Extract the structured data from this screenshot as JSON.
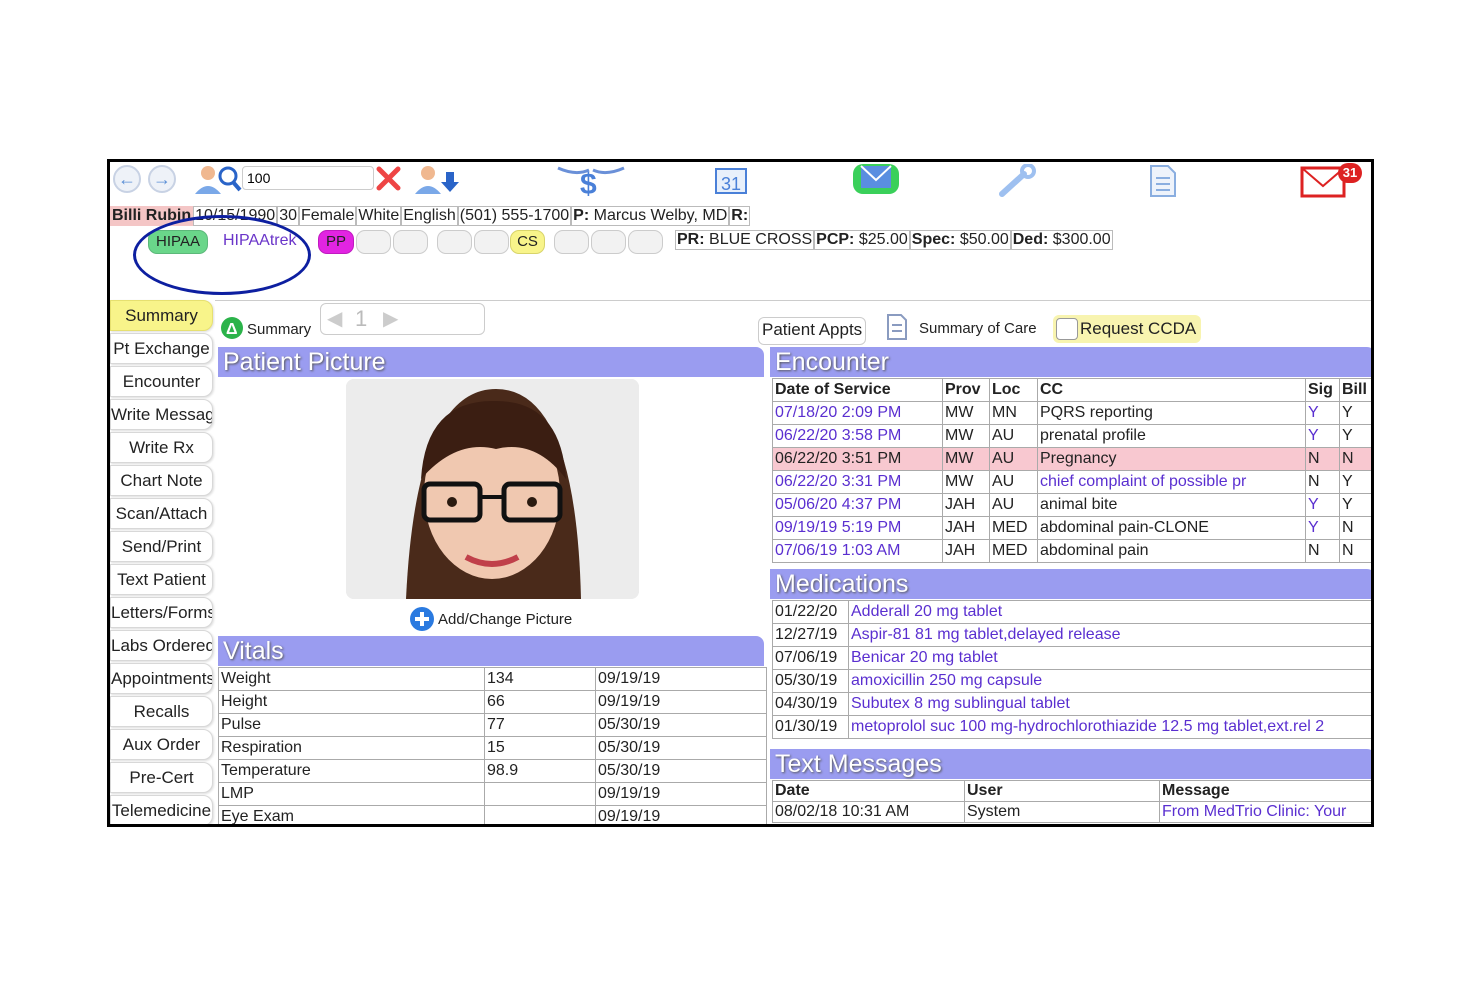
{
  "toolbar": {
    "search_value": "100",
    "mail_badge": "31",
    "icons": [
      "back-icon",
      "forward-icon",
      "patient-search-icon",
      "clear-icon",
      "patient-download-icon",
      "billing-icon",
      "calendar-icon",
      "inbox-icon",
      "tools-icon",
      "document-icon",
      "mail-icon"
    ]
  },
  "patient": {
    "name": "Billi Rubin",
    "dob": "10/15/1990",
    "age": "30",
    "sex": "Female",
    "race": "White",
    "language": "English",
    "phone": "(501) 555-1700",
    "provider_label": "P:",
    "provider": "Marcus Welby, MD",
    "referral_label": "R:"
  },
  "chips": {
    "hipaa": "HIPAA",
    "hipaatrek": "HIPAAtrek",
    "pp": "PP",
    "cs": "CS"
  },
  "insurance": {
    "pr_label": "PR:",
    "pr": "BLUE CROSS",
    "pcp_label": "PCP:",
    "pcp": "$25.00",
    "spec_label": "Spec:",
    "spec": "$50.00",
    "ded_label": "Ded:",
    "ded": "$300.00"
  },
  "sidebar": [
    "Summary",
    "Pt Exchange",
    "Encounter",
    "Write Message",
    "Write Rx",
    "Chart Note",
    "Scan/Attach",
    "Send/Print",
    "Text Patient",
    "Letters/Forms",
    "Labs Ordered",
    "Appointments",
    "Recalls",
    "Aux Order",
    "Pre-Cert",
    "Telemedicine"
  ],
  "mainbar": {
    "summary_label": "Summary",
    "page_num": "1",
    "patient_appts": "Patient Appts",
    "summary_of_care": "Summary of Care",
    "request_ccda": "Request CCDA"
  },
  "picture": {
    "title": "Patient Picture",
    "add_change": "Add/Change Picture"
  },
  "vitals": {
    "title": "Vitals",
    "rows": [
      [
        "Weight",
        "134",
        "09/19/19"
      ],
      [
        "Height",
        "66",
        "09/19/19"
      ],
      [
        "Pulse",
        "77",
        "05/30/19"
      ],
      [
        "Respiration",
        "15",
        "05/30/19"
      ],
      [
        "Temperature",
        "98.9",
        "05/30/19"
      ],
      [
        "LMP",
        "",
        "09/19/19"
      ],
      [
        "Eye Exam",
        "",
        "09/19/19"
      ]
    ]
  },
  "encounter": {
    "title": "Encounter",
    "headers": [
      "Date of Service",
      "Prov",
      "Loc",
      "CC",
      "Sig",
      "Bill"
    ],
    "rows": [
      [
        "07/18/20 2:09 PM",
        "MW",
        "MN",
        "PQRS reporting",
        "Y",
        "Y"
      ],
      [
        "06/22/20 3:58 PM",
        "MW",
        "AU",
        "prenatal profile",
        "Y",
        "Y"
      ],
      [
        "06/22/20 3:51 PM",
        "MW",
        "AU",
        "Pregnancy",
        "N",
        "N"
      ],
      [
        "06/22/20 3:31 PM",
        "MW",
        "AU",
        "chief complaint of possible pr",
        "N",
        "Y"
      ],
      [
        "05/06/20 4:37 PM",
        "JAH",
        "AU",
        "animal bite",
        "Y",
        "Y"
      ],
      [
        "09/19/19 5:19 PM",
        "JAH",
        "MED",
        "abdominal pain-CLONE",
        "Y",
        "N"
      ],
      [
        "07/06/19 1:03 AM",
        "JAH",
        "MED",
        "abdominal pain",
        "N",
        "N"
      ]
    ]
  },
  "medications": {
    "title": "Medications",
    "rows": [
      [
        "01/22/20",
        "Adderall 20 mg tablet"
      ],
      [
        "12/27/19",
        "Aspir-81 81 mg tablet,delayed release"
      ],
      [
        "07/06/19",
        "Benicar 20 mg tablet"
      ],
      [
        "05/30/19",
        "amoxicillin 250 mg capsule"
      ],
      [
        "04/30/19",
        "Subutex 8 mg sublingual tablet"
      ],
      [
        "01/30/19",
        "metoprolol suc 100 mg-hydrochlorothiazide 12.5 mg tablet,ext.rel 2"
      ]
    ]
  },
  "text_messages": {
    "title": "Text Messages",
    "headers": [
      "Date",
      "User",
      "Message"
    ],
    "rows": [
      [
        "08/02/18 10:31 AM",
        "System",
        "From MedTrio Clinic: Your"
      ]
    ]
  },
  "colors": {
    "header_blue": "#9a9cf0",
    "link": "#5a2fd0",
    "active_tab": "#f8f48a",
    "highlight_row": "#f8c8d0"
  }
}
